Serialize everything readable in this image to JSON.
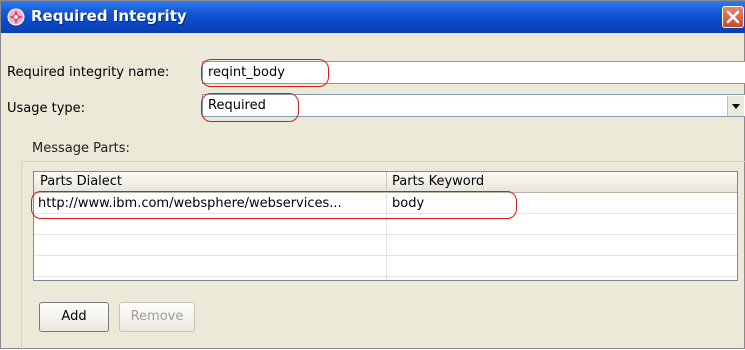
{
  "window": {
    "title": "Required Integrity"
  },
  "form": {
    "name_label": "Required integrity name:",
    "name_value": "reqint_body",
    "usage_label": "Usage type:",
    "usage_value": "Required"
  },
  "message_parts": {
    "group_label": "Message Parts:",
    "columns": [
      "Parts Dialect",
      "Parts Keyword"
    ],
    "rows": [
      {
        "dialect": "http://www.ibm.com/websphere/webservices...",
        "keyword": "body"
      }
    ]
  },
  "buttons": {
    "add": "Add",
    "remove": "Remove"
  },
  "colors": {
    "annotation": "#d0201c",
    "titlebar": "#0a47c4"
  },
  "icons": {
    "window": "integrity-cross-icon",
    "close": "close-x-icon",
    "dropdown": "triangle-down-icon"
  }
}
